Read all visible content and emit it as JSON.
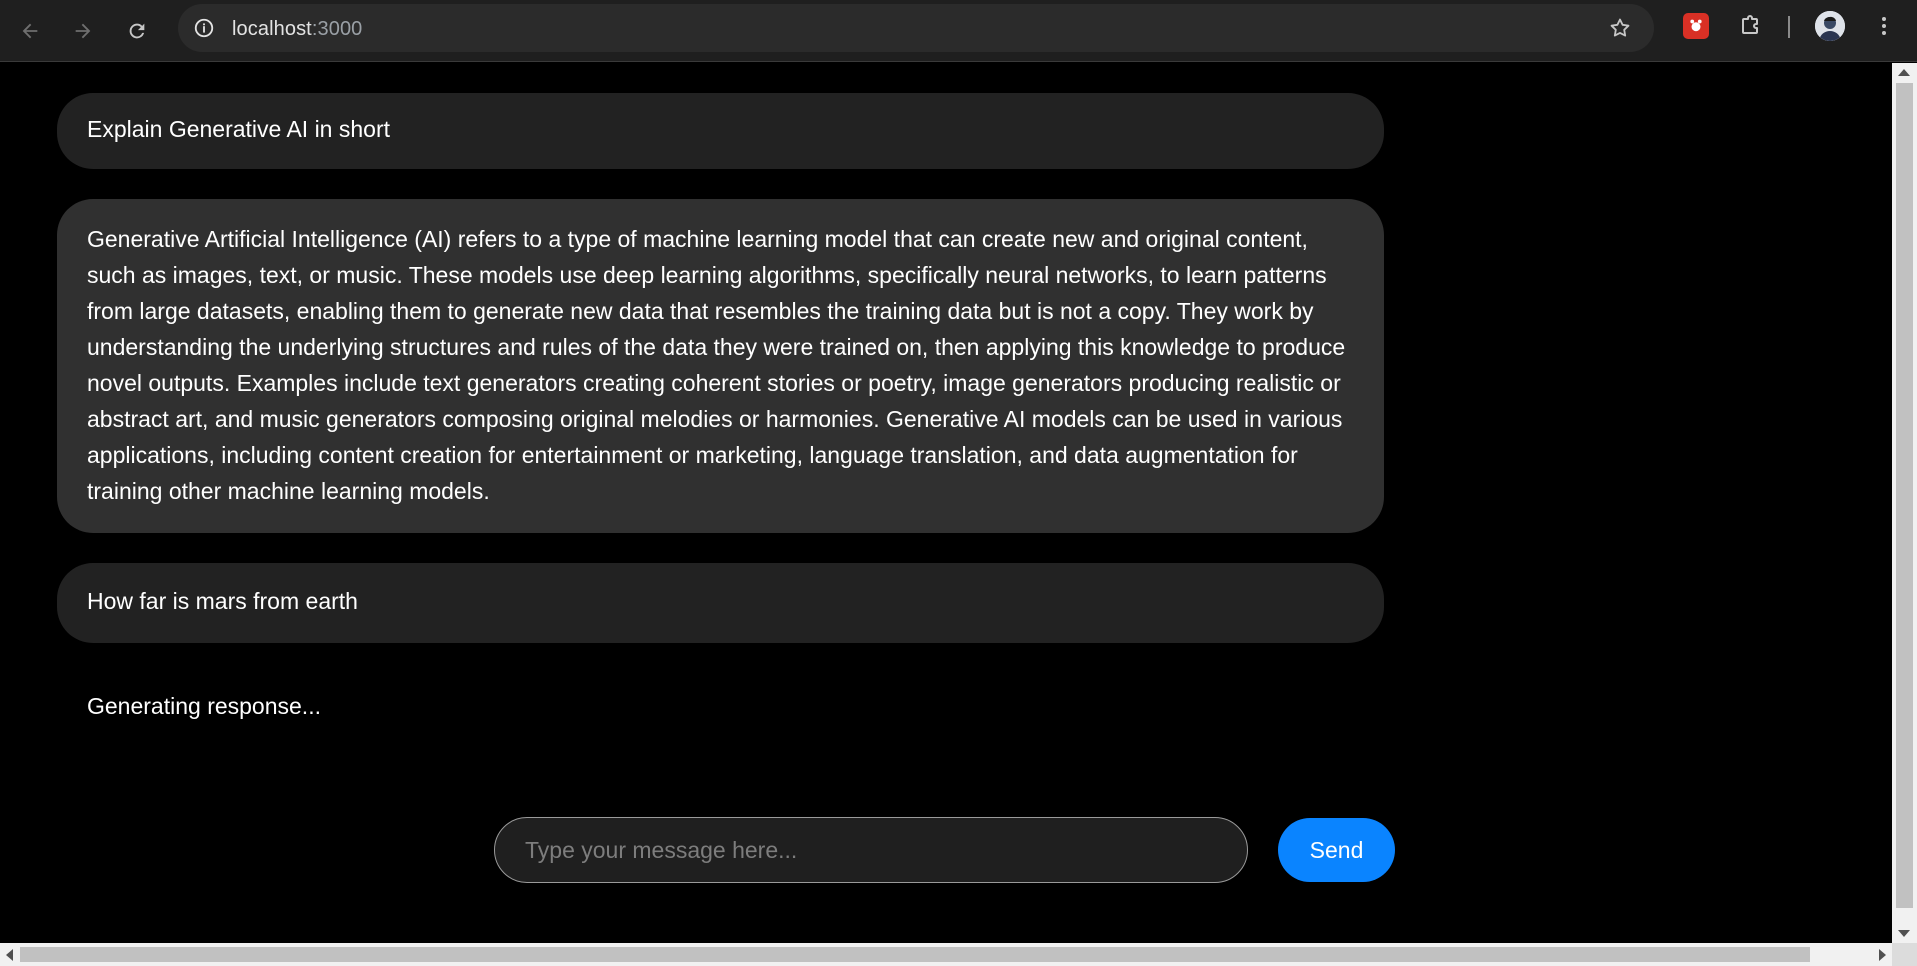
{
  "browser": {
    "url_host": "localhost",
    "url_port": ":3000",
    "icons": {
      "back": "arrow-left-icon",
      "forward": "arrow-right-icon",
      "reload": "reload-icon",
      "site_info": "info-icon",
      "bookmark": "star-icon",
      "extension": "extension-icon",
      "extensions_menu": "puzzle-icon",
      "profile": "avatar",
      "menu": "kebab-menu-icon"
    }
  },
  "chat": {
    "messages": [
      {
        "role": "user",
        "text": "Explain Generative AI in short"
      },
      {
        "role": "assistant",
        "text": "Generative Artificial Intelligence (AI) refers to a type of machine learning model that can create new and original content, such as images, text, or music. These models use deep learning algorithms, specifically neural networks, to learn patterns from large datasets, enabling them to generate new data that resembles the training data but is not a copy. They work by understanding the underlying structures and rules of the data they were trained on, then applying this knowledge to produce novel outputs. Examples include text generators creating coherent stories or poetry, image generators producing realistic or abstract art, and music generators composing original melodies or harmonies. Generative AI models can be used in various applications, including content creation for entertainment or marketing, language translation, and data augmentation for training other machine learning models."
      },
      {
        "role": "user",
        "text": "How far is mars from earth"
      }
    ],
    "status": "Generating response...",
    "input": {
      "value": "",
      "placeholder": "Type your message here..."
    },
    "send_label": "Send"
  },
  "colors": {
    "page_bg": "#000000",
    "user_bubble": "#222222",
    "assistant_bubble": "#303030",
    "send_button": "#0a84ff",
    "chrome_toolbar": "#1f1f1f"
  }
}
